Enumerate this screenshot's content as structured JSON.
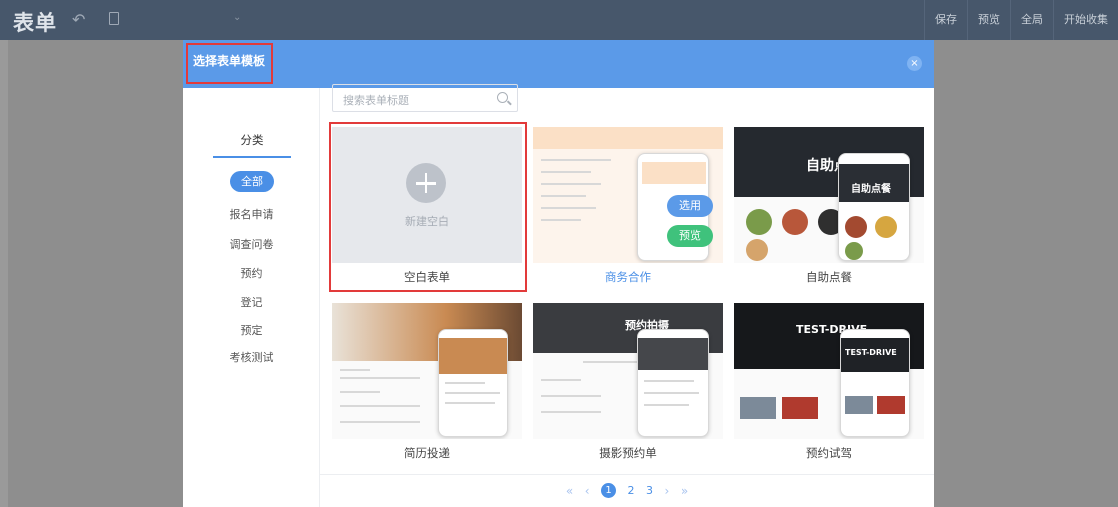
{
  "app": {
    "logo": "表单",
    "toolbar": [
      "保存",
      "预览",
      "全局",
      "开始收集"
    ]
  },
  "dialog": {
    "title": "选择表单模板",
    "close": "×",
    "sidebar": {
      "header": "分类",
      "categories": [
        "全部",
        "报名申请",
        "调查问卷",
        "预约",
        "登记",
        "预定",
        "考核测试"
      ],
      "active_index": 0
    },
    "search": {
      "placeholder": "搜索表单标题"
    },
    "templates": [
      {
        "name": "空白表单",
        "thumb_text": "新建空白",
        "selected": true
      },
      {
        "name": "商务合作",
        "hover_select": "选用",
        "hover_preview": "预览",
        "hovered": true
      },
      {
        "name": "自助点餐",
        "thumb_text": "自助点餐",
        "thumb_text2": "自助点餐"
      },
      {
        "name": "简历投递"
      },
      {
        "name": "摄影预约单",
        "thumb_text": "预约拍摄"
      },
      {
        "name": "预约试驾",
        "thumb_text": "TEST-DRIVE",
        "thumb_text2": "TEST-DRIVE"
      }
    ],
    "pager": {
      "first": "«",
      "prev": "‹",
      "pages": [
        "1",
        "2",
        "3"
      ],
      "current": "1",
      "next": "›",
      "last": "»"
    }
  },
  "colors": {
    "accent": "#4a8fe6",
    "highlight": "#e23a3a",
    "topbar": "#47576b",
    "select_btn": "#5b9ae8",
    "preview_btn": "#3fc27c"
  }
}
